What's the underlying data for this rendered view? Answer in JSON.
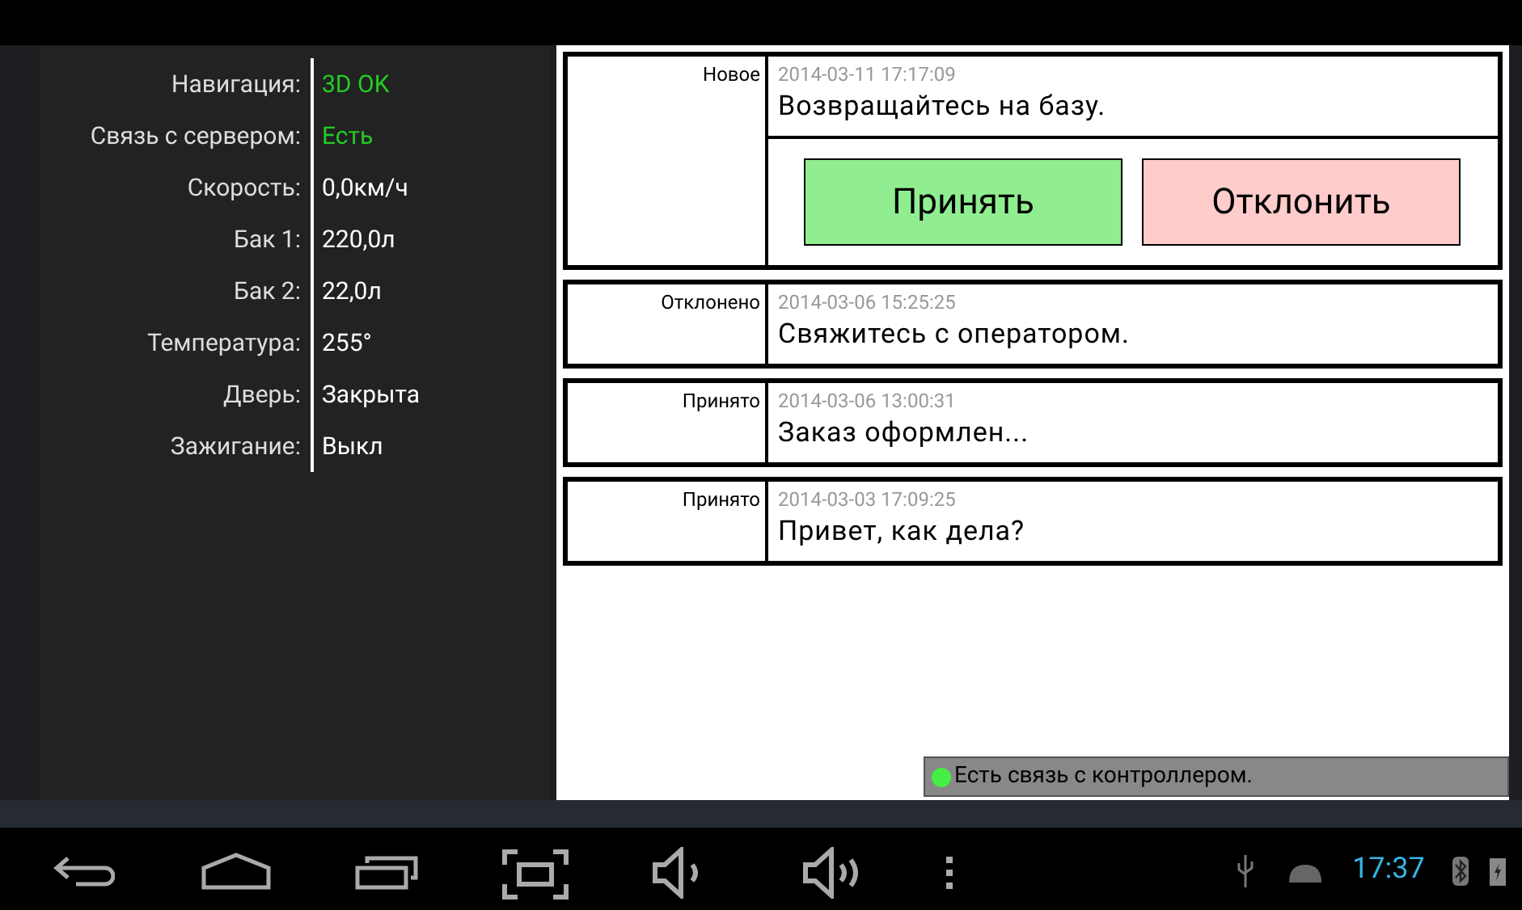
{
  "status_panel": [
    {
      "label": "Навигация:",
      "value": "3D OK",
      "color": "#22cc22"
    },
    {
      "label": "Связь с сервером:",
      "value": "Есть",
      "color": "#22cc22"
    },
    {
      "label": "Скорость:",
      "value": "0,0км/ч",
      "color": "#ffffff"
    },
    {
      "label": "Бак 1:",
      "value": "220,0л",
      "color": "#ffffff"
    },
    {
      "label": "Бак 2:",
      "value": "22,0л",
      "color": "#ffffff"
    },
    {
      "label": "Температура:",
      "value": "255°",
      "color": "#ffffff"
    },
    {
      "label": "Дверь:",
      "value": "Закрыта",
      "color": "#ffffff"
    },
    {
      "label": "Зажигание:",
      "value": "Выкл",
      "color": "#ffffff"
    }
  ],
  "messages": [
    {
      "status": "Новое",
      "time": "2014-03-11 17:17:09",
      "text": "Возвращайтесь на базу.",
      "actions": [
        {
          "label": "Принять",
          "color": "#90ee90"
        },
        {
          "label": "Отклонить",
          "color": "#ffcccc"
        }
      ]
    },
    {
      "status": "Отклонено",
      "time": "2014-03-06 15:25:25",
      "text": "Свяжитесь с оператором."
    },
    {
      "status": "Принято",
      "time": "2014-03-06 13:00:31",
      "text": "Заказ оформлен..."
    },
    {
      "status": "Принято",
      "time": "2014-03-03 17:09:25",
      "text": "Привет, как дела?"
    }
  ],
  "connection": {
    "text": "Есть связь с контроллером.",
    "color": "#44ee44"
  },
  "system_bar": {
    "time": "17:37"
  }
}
